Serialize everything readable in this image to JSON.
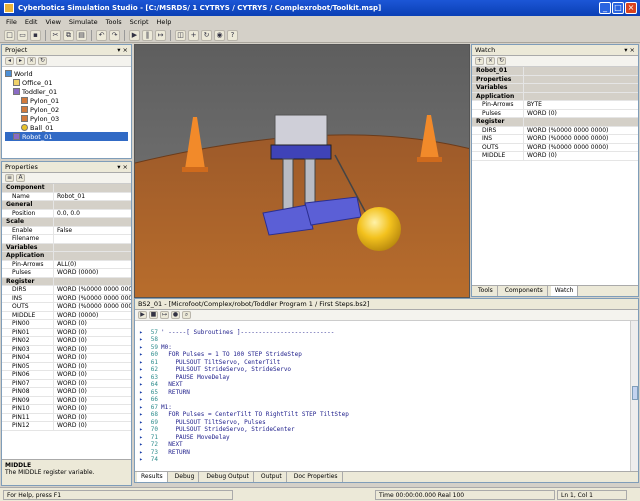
{
  "window": {
    "title": "Cyberbotics Simulation Studio - [C:/MSRDS/ 1 CYTRYS / CYTRYS / Complexrobot/Toolkit.msp]",
    "controls": [
      "_",
      "□",
      "×"
    ]
  },
  "menu": [
    "File",
    "Edit",
    "View",
    "Simulate",
    "Tools",
    "Script",
    "Help"
  ],
  "toolbar": {
    "icons": [
      "new-icon",
      "open-icon",
      "save-icon",
      "cut-icon",
      "copy-icon",
      "paste-icon",
      "undo-icon",
      "redo-icon",
      "run-icon",
      "pause-icon",
      "step-icon",
      "view-icon",
      "zoom-icon",
      "rotate-icon",
      "camera-icon",
      "help-icon"
    ]
  },
  "project_panel": {
    "title": "Project",
    "items": [
      {
        "label": "World",
        "icon": "world-icon",
        "level": 0
      },
      {
        "label": "Office_01",
        "icon": "folder-icon",
        "level": 1
      },
      {
        "label": "Toddler_01",
        "icon": "robot-icon",
        "level": 1
      },
      {
        "label": "Pylon_01",
        "icon": "body-icon",
        "level": 2
      },
      {
        "label": "Pylon_02",
        "icon": "body-icon",
        "level": 2
      },
      {
        "label": "Pylon_03",
        "icon": "body-icon",
        "level": 2
      },
      {
        "label": "Ball_01",
        "icon": "ball-icon",
        "level": 2
      },
      {
        "label": "Robot_01",
        "icon": "robot-icon",
        "level": 1
      }
    ]
  },
  "properties_panel": {
    "title": "Properties",
    "rows": [
      {
        "k": "Component",
        "v": "",
        "type": "cat"
      },
      {
        "k": "Name",
        "v": "Robot_01",
        "type": "sub"
      },
      {
        "k": "General",
        "v": "",
        "type": "cat"
      },
      {
        "k": "Position",
        "v": "0.0, 0.0",
        "type": "sub"
      },
      {
        "k": "Scale",
        "v": "",
        "type": "cat"
      },
      {
        "k": "Enable",
        "v": "False",
        "type": "sub"
      },
      {
        "k": "Filename",
        "v": "",
        "type": "sub"
      },
      {
        "k": "Variables",
        "v": "",
        "type": "cat"
      },
      {
        "k": "Application",
        "v": "",
        "type": "cat"
      },
      {
        "k": "Pin-Arrows",
        "v": "ALL(0)",
        "type": "sub"
      },
      {
        "k": "Pulses",
        "v": "WORD (0000)",
        "type": "sub"
      },
      {
        "k": "Register",
        "v": "",
        "type": "cat"
      },
      {
        "k": "DIRS",
        "v": "WORD (%0000 0000 0000)",
        "type": "sub"
      },
      {
        "k": "INS",
        "v": "WORD (%0000 0000 0000)",
        "type": "sub"
      },
      {
        "k": "OUTS",
        "v": "WORD (%0000 0000 0000)",
        "type": "sub"
      },
      {
        "k": "MIDDLE",
        "v": "WORD (0000)",
        "type": "sub"
      },
      {
        "k": "PIN00",
        "v": "WORD (0)",
        "type": "sub"
      },
      {
        "k": "PIN01",
        "v": "WORD (0)",
        "type": "sub"
      },
      {
        "k": "PIN02",
        "v": "WORD (0)",
        "type": "sub"
      },
      {
        "k": "PIN03",
        "v": "WORD (0)",
        "type": "sub"
      },
      {
        "k": "PIN04",
        "v": "WORD (0)",
        "type": "sub"
      },
      {
        "k": "PIN05",
        "v": "WORD (0)",
        "type": "sub"
      },
      {
        "k": "PIN06",
        "v": "WORD (0)",
        "type": "sub"
      },
      {
        "k": "PIN07",
        "v": "WORD (0)",
        "type": "sub"
      },
      {
        "k": "PIN08",
        "v": "WORD (0)",
        "type": "sub"
      },
      {
        "k": "PIN09",
        "v": "WORD (0)",
        "type": "sub"
      },
      {
        "k": "PIN10",
        "v": "WORD (0)",
        "type": "sub"
      },
      {
        "k": "PIN11",
        "v": "WORD (0)",
        "type": "sub"
      },
      {
        "k": "PIN12",
        "v": "WORD (0)",
        "type": "sub"
      }
    ],
    "description_title": "MIDDLE",
    "description_text": "The MIDDLE register variable."
  },
  "watch_panel": {
    "title": "Watch",
    "rows": [
      {
        "k": "Robot_01",
        "v": "",
        "type": "cat"
      },
      {
        "k": "Properties",
        "v": "",
        "type": "cat"
      },
      {
        "k": "Variables",
        "v": "",
        "type": "cat"
      },
      {
        "k": "Application",
        "v": "",
        "type": "cat"
      },
      {
        "k": "Pin-Arrows",
        "v": "BYTE",
        "type": "sub"
      },
      {
        "k": "Pulses",
        "v": "WORD (0)",
        "type": "sub"
      },
      {
        "k": "Register",
        "v": "",
        "type": "cat"
      },
      {
        "k": "DIRS",
        "v": "WORD (%0000 0000 0000)",
        "type": "sub"
      },
      {
        "k": "INS",
        "v": "WORD (%0000 0000 0000)",
        "type": "sub"
      },
      {
        "k": "OUTS",
        "v": "WORD (%0000 0000 0000)",
        "type": "sub"
      },
      {
        "k": "MIDDLE",
        "v": "WORD (0)",
        "type": "sub"
      }
    ],
    "tabs": [
      "Tools",
      "Components",
      "Watch"
    ]
  },
  "editor": {
    "header": "BS2_01 - [Microfoot/Complex/robot/Toddler Program 1 / First Steps.bs2]",
    "lines": [
      {
        "n": "",
        "t": ""
      },
      {
        "n": "57",
        "t": "' -----[ Subroutines ]--------------------------"
      },
      {
        "n": "58",
        "t": ""
      },
      {
        "n": "59",
        "t": "M0:"
      },
      {
        "n": "60",
        "t": "  FOR Pulses = 1 TO 100 STEP StrideStep"
      },
      {
        "n": "61",
        "t": "    PULSOUT TiltServo, CenterTilt"
      },
      {
        "n": "62",
        "t": "    PULSOUT StrideServo, StrideServo"
      },
      {
        "n": "63",
        "t": "    PAUSE MoveDelay"
      },
      {
        "n": "64",
        "t": "  NEXT"
      },
      {
        "n": "65",
        "t": "  RETURN"
      },
      {
        "n": "66",
        "t": ""
      },
      {
        "n": "67",
        "t": "M1:"
      },
      {
        "n": "68",
        "t": "  FOR Pulses = CenterTilt TO RightTilt STEP TiltStep"
      },
      {
        "n": "69",
        "t": "    PULSOUT TiltServo, Pulses"
      },
      {
        "n": "70",
        "t": "    PULSOUT StrideServo, StrideCenter"
      },
      {
        "n": "71",
        "t": "    PAUSE MoveDelay"
      },
      {
        "n": "72",
        "t": "  NEXT"
      },
      {
        "n": "73",
        "t": "  RETURN"
      },
      {
        "n": "74",
        "t": ""
      }
    ],
    "tabs": [
      "Results",
      "Debug",
      "Debug Output",
      "Output",
      "Doc Properties"
    ]
  },
  "status": {
    "left": "For Help, press F1",
    "middle": "Time 00:00:00.000  Real 100",
    "right": "Ln 1, Col 1"
  },
  "colors": {
    "title_bar": "#0a3fb5",
    "viewport_sky": "#6c6c6c",
    "floor": "#a25a24",
    "ball": "#f3c21e",
    "robot_base": "#5b5fd6",
    "code_text": "#1c1c8a"
  }
}
